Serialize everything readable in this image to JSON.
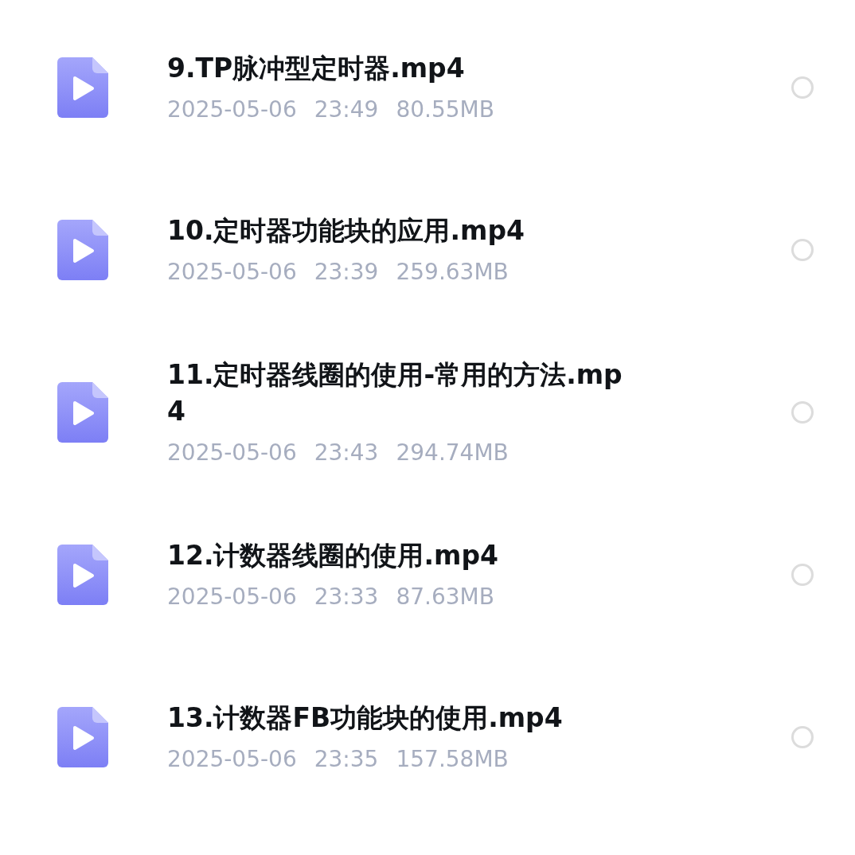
{
  "files": [
    {
      "name": "9.TP脉冲型定时器.mp4",
      "date": "2025-05-06",
      "time": "23:49",
      "size": "80.55MB",
      "selected": false
    },
    {
      "name": "10.定时器功能块的应用.mp4",
      "date": "2025-05-06",
      "time": "23:39",
      "size": "259.63MB",
      "selected": false
    },
    {
      "name": "11.定时器线圈的使用-常用的方法.mp4",
      "date": "2025-05-06",
      "time": "23:43",
      "size": "294.74MB",
      "selected": false
    },
    {
      "name": "12.计数器线圈的使用.mp4",
      "date": "2025-05-06",
      "time": "23:33",
      "size": "87.63MB",
      "selected": false
    },
    {
      "name": "13.计数器FB功能块的使用.mp4",
      "date": "2025-05-06",
      "time": "23:35",
      "size": "157.58MB",
      "selected": false
    }
  ]
}
